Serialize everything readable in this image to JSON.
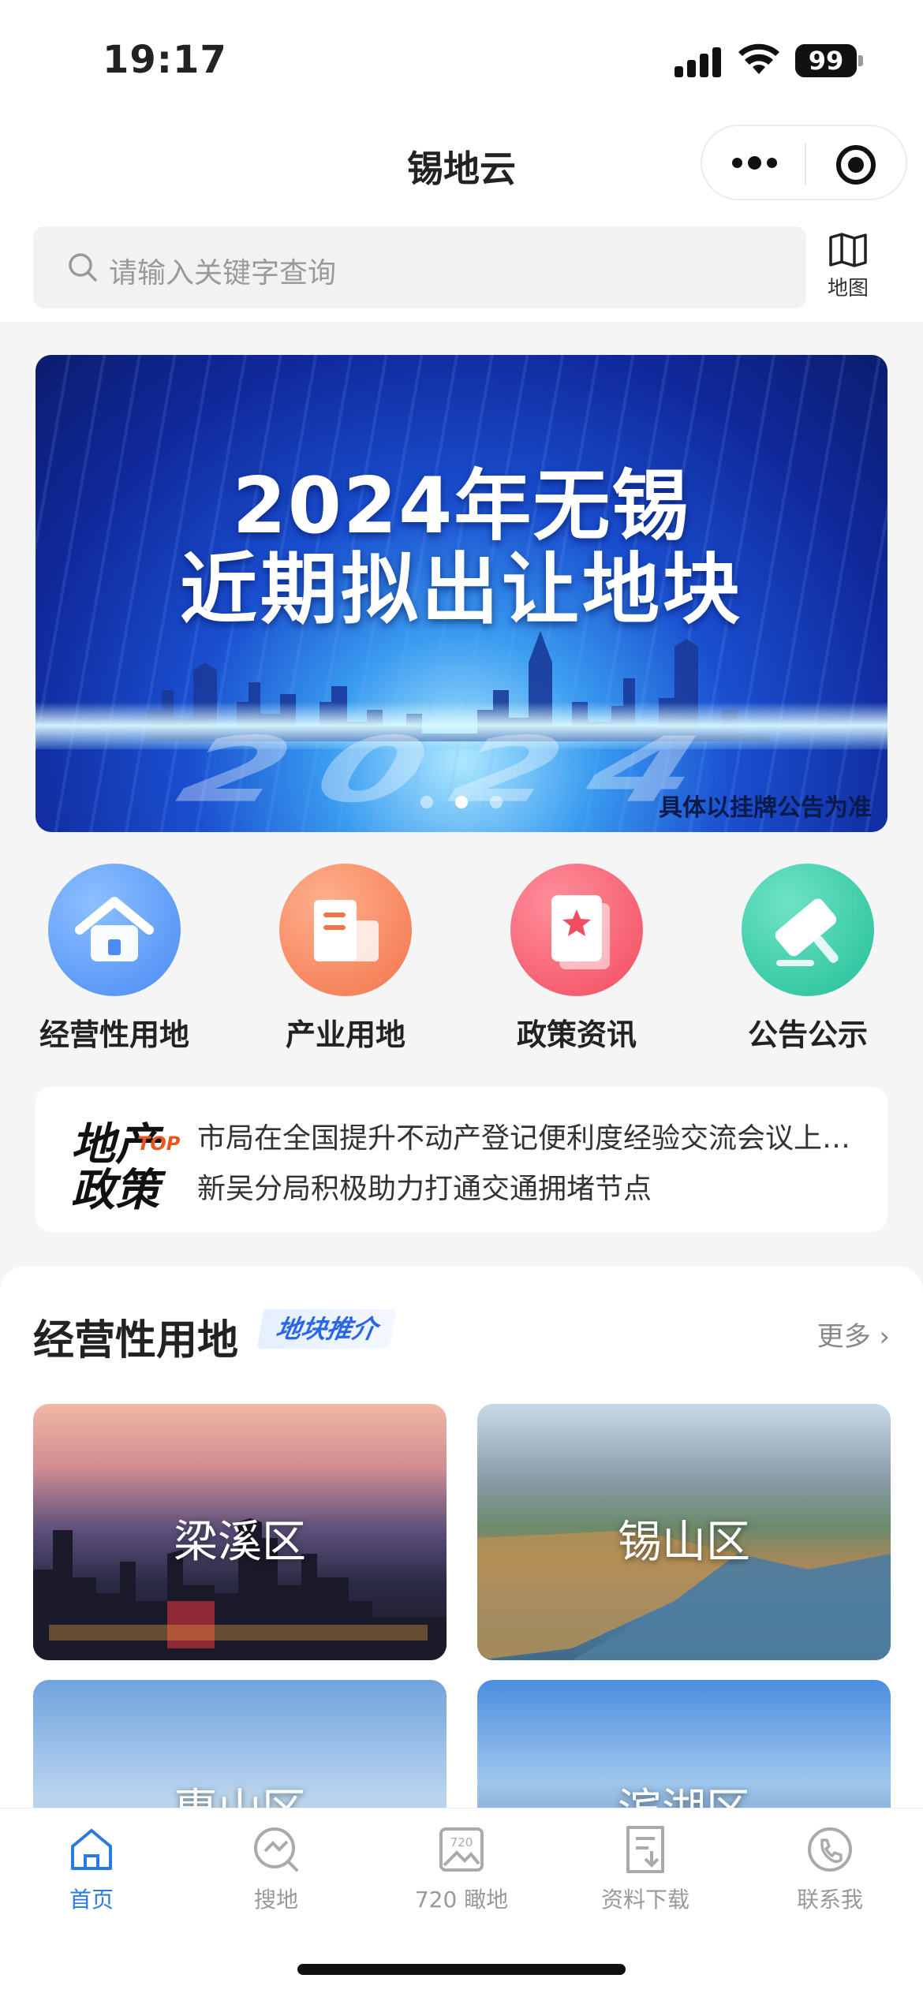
{
  "status_bar": {
    "time": "19:17",
    "battery": "99"
  },
  "navbar": {
    "title": "锡地云"
  },
  "search": {
    "placeholder": "请输入关键字查询",
    "map_label": "地图"
  },
  "banner": {
    "title_line1": "2024年无锡",
    "title_line2": "近期拟出让地块",
    "year_watermark": "2024",
    "note": "具体以挂牌公告为准",
    "slide_count": 3,
    "active_slide": 2
  },
  "categories": [
    {
      "label": "经营性用地",
      "icon": "house-icon",
      "color": "#5b9cf8"
    },
    {
      "label": "产业用地",
      "icon": "building-icon",
      "color": "#f7875a"
    },
    {
      "label": "政策资讯",
      "icon": "document-star-icon",
      "color": "#f5586a"
    },
    {
      "label": "公告公示",
      "icon": "gavel-icon",
      "color": "#35c9a6"
    }
  ],
  "news": {
    "logo_line1": "地产",
    "logo_line2": "政策",
    "logo_top": "TOP",
    "items": [
      "市局在全国提升不动产登记便利度经验交流会议上…",
      "新吴分局积极助力打通交通拥堵节点"
    ]
  },
  "section": {
    "title": "经营性用地",
    "tag": "地块推介",
    "more": "更多",
    "districts": [
      "梁溪区",
      "锡山区",
      "惠山区",
      "滨湖区"
    ]
  },
  "tabbar": [
    {
      "label": "首页",
      "icon": "home-icon",
      "active": true
    },
    {
      "label": "搜地",
      "icon": "search-land-icon",
      "active": false
    },
    {
      "label": "720 瞰地",
      "icon": "panorama-icon",
      "active": false
    },
    {
      "label": "资料下载",
      "icon": "download-doc-icon",
      "active": false
    },
    {
      "label": "联系我",
      "icon": "phone-icon",
      "active": false
    }
  ],
  "colors": {
    "accent": "#2a7ae2",
    "tag": "#2a66e8"
  }
}
